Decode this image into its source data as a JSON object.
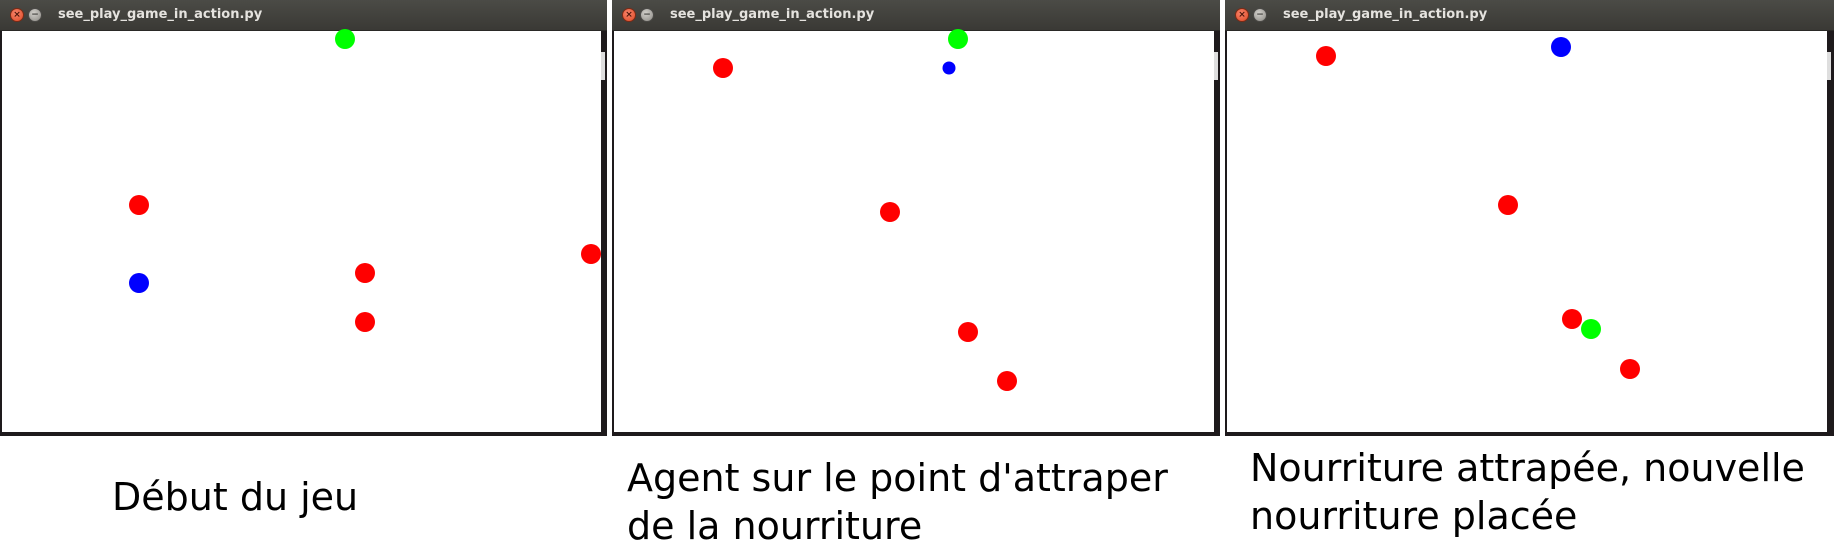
{
  "colors": {
    "food": "#ff0000",
    "agent": "#0000ff",
    "target": "#00ff00",
    "background": "#ffffff"
  },
  "panels": [
    {
      "window_title": "see_play_game_in_action.py",
      "caption_lines": [
        "Début du jeu"
      ]
    },
    {
      "window_title": "see_play_game_in_action.py",
      "caption_lines": [
        "Agent sur le point d'attraper",
        "de la nourriture"
      ]
    },
    {
      "window_title": "see_play_game_in_action.py",
      "caption_lines": [
        "Nourriture attrapée, nouvelle",
        "nourriture placée"
      ]
    }
  ]
}
